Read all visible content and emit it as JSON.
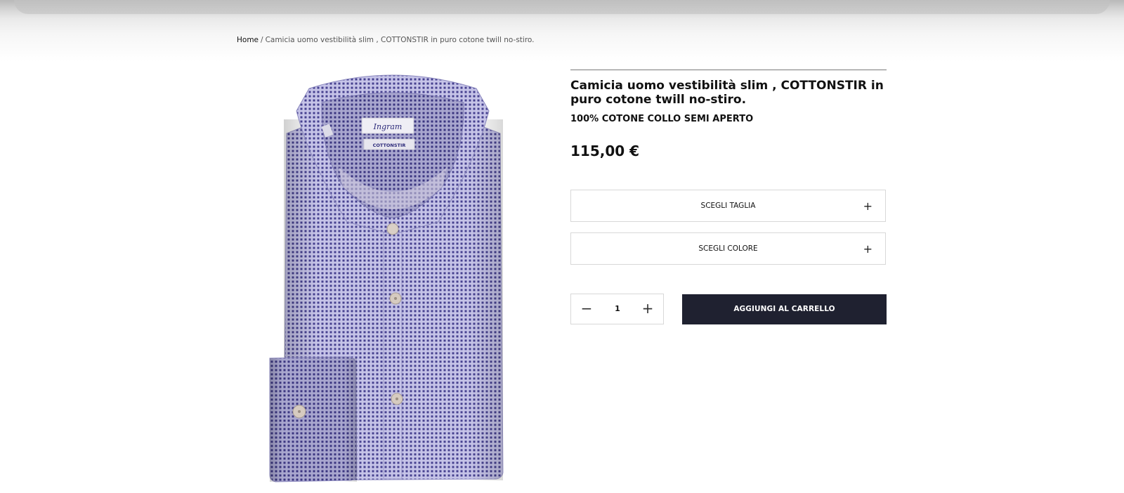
{
  "breadcrumb": {
    "home": "Home",
    "separator": "/",
    "current": "Camicia uomo vestibilità slim , COTTONSTIR in puro cotone twill no-stiro."
  },
  "product": {
    "image_icon": "shirt-image",
    "image_labels": {
      "brand_label": "Ingram",
      "size_label": "COTTONSTIR"
    },
    "title": "Camicia uomo vestibilità slim , COTTONSTIR in puro cotone twill no-stiro.",
    "subtitle": "100% COTONE COLLO SEMI APERTO",
    "price": "115,00 €"
  },
  "options": {
    "size_label": "SCEGLI TAGLIA",
    "color_label": "SCEGLI COLORE",
    "expand_symbol": "+"
  },
  "cart": {
    "quantity": "1",
    "minus_symbol": "−",
    "plus_symbol": "+",
    "add_label": "AGGIUNGI AL CARRELLO"
  },
  "colors": {
    "button_bg": "#1f2130",
    "shirt_base": "#c3c1e6",
    "shirt_dots": "#3f3a8a"
  }
}
